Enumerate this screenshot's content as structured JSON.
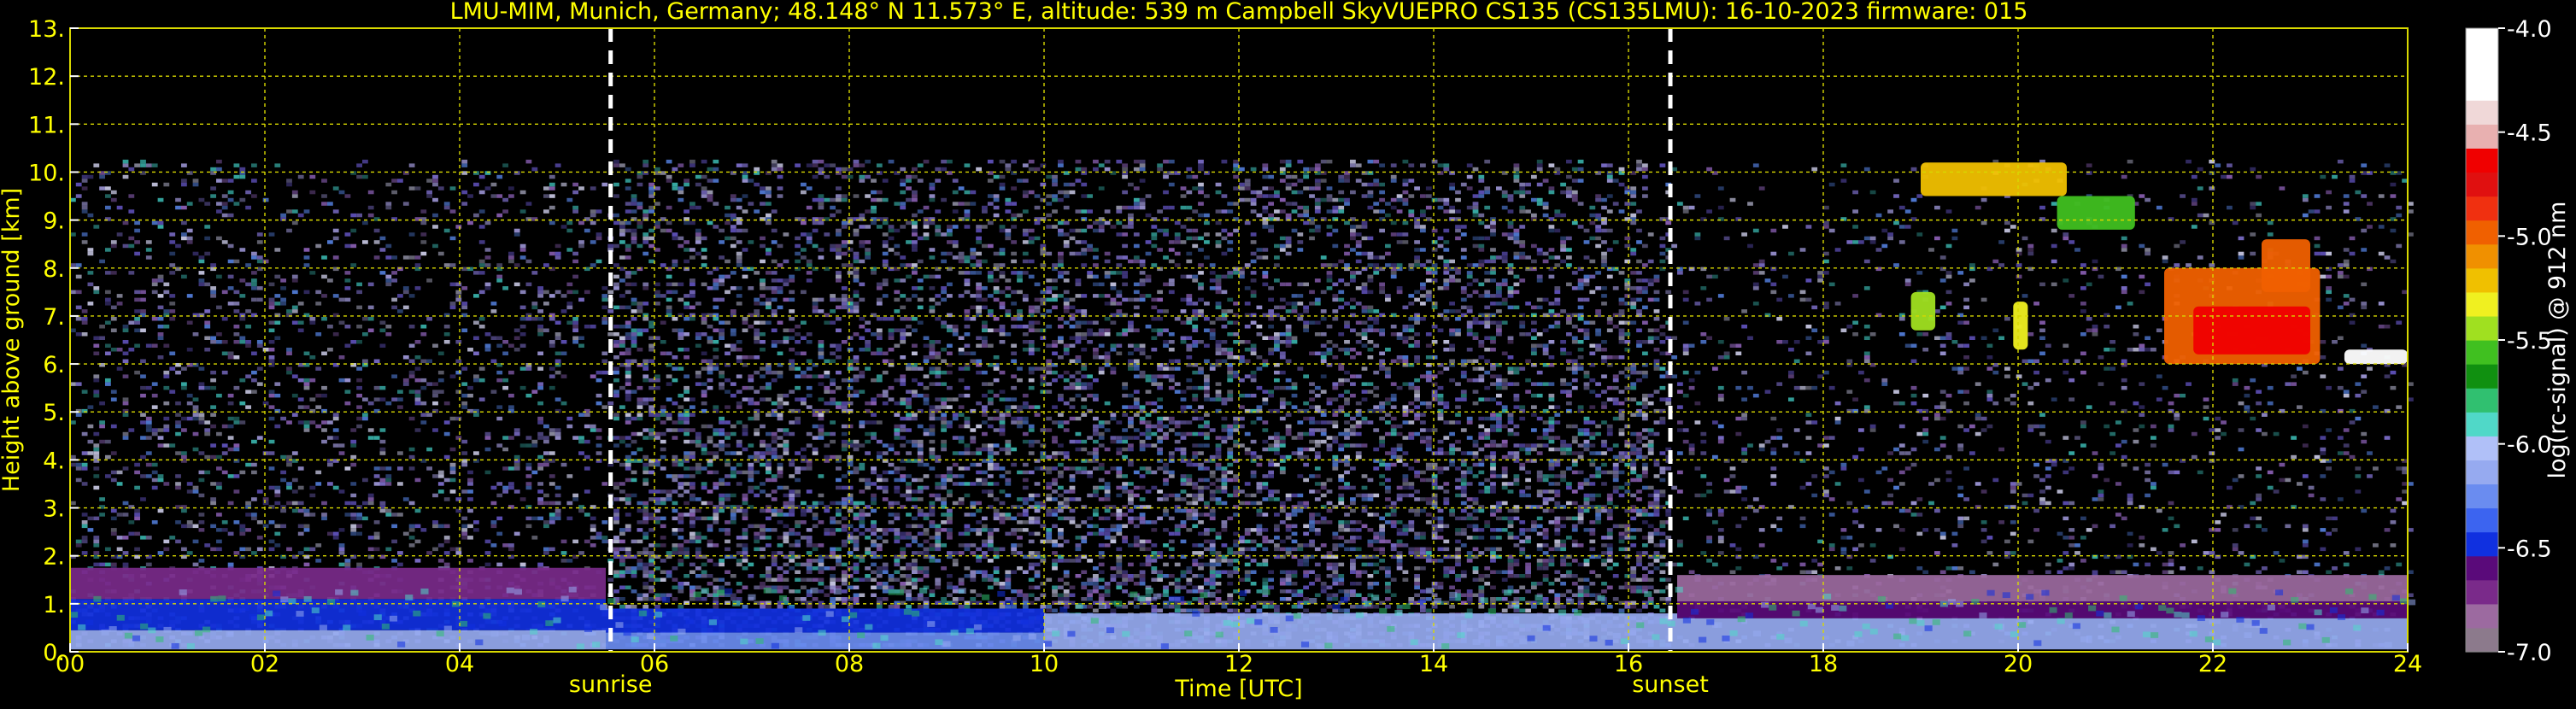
{
  "chart_data": {
    "type": "heatmap",
    "title": "LMU-MIM, Munich, Germany; 48.148° N 11.573° E, altitude: 539 m    Campbell SkyVUEPRO CS135 (CS135LMU): 16-10-2023    firmware: 015",
    "xlabel": "Time [UTC]",
    "ylabel": "Height above ground [km]",
    "colorbar_label": "log(rc-signal) @ 912 nm",
    "xlim": [
      0,
      24
    ],
    "ylim": [
      0,
      13
    ],
    "x_ticks": [
      0,
      2,
      4,
      6,
      8,
      10,
      12,
      14,
      16,
      18,
      20,
      22,
      24
    ],
    "x_tick_labels": [
      "00",
      "02",
      "04",
      "06",
      "08",
      "10",
      "12",
      "14",
      "16",
      "18",
      "20",
      "22",
      "24"
    ],
    "y_ticks": [
      0,
      1,
      2,
      3,
      4,
      5,
      6,
      7,
      8,
      9,
      10,
      11,
      12,
      13
    ],
    "y_tick_labels": [
      "0.",
      "1.",
      "2.",
      "3.",
      "4.",
      "5.",
      "6.",
      "7.",
      "8.",
      "9.",
      "10.",
      "11.",
      "12.",
      "13."
    ],
    "grid": true,
    "colorbar": {
      "ticks": [
        -4.0,
        -4.5,
        -5.0,
        -5.5,
        -6.0,
        -6.5,
        -7.0
      ],
      "tick_labels": [
        "-4.0",
        "-4.5",
        "-5.0",
        "-5.5",
        "-6.0",
        "-6.5",
        "-7.0"
      ],
      "range": [
        -7.0,
        -4.0
      ],
      "colors": [
        "#8c7a8c",
        "#9c6aa0",
        "#7a2a8a",
        "#5a0a7a",
        "#1030e0",
        "#3c64f0",
        "#6a8cf0",
        "#96aaf0",
        "#b0c0f8",
        "#50d8c8",
        "#30c070",
        "#109010",
        "#40c020",
        "#a0e020",
        "#f0f020",
        "#f0c000",
        "#f09000",
        "#f06000",
        "#f03010",
        "#e01010",
        "#f00000",
        "#e8b0b0",
        "#f0d8d8",
        "#ffffff",
        "#ffffff",
        "#ffffff"
      ]
    },
    "annotations": [
      {
        "label": "sunrise",
        "x": 5.55
      },
      {
        "label": "sunset",
        "x": 16.43
      }
    ],
    "signal_top_km": 10.2,
    "layers": [
      {
        "t0": 0.0,
        "t1": 5.5,
        "h0": 0.05,
        "h1": 0.45,
        "level": -6.1
      },
      {
        "t0": 0.0,
        "t1": 5.5,
        "h0": 0.45,
        "h1": 1.1,
        "level": -6.5
      },
      {
        "t0": 0.0,
        "t1": 5.5,
        "h0": 1.1,
        "h1": 1.75,
        "level": -6.75
      },
      {
        "t0": 5.5,
        "t1": 10.0,
        "h0": 0.05,
        "h1": 0.4,
        "level": -6.25
      },
      {
        "t0": 5.5,
        "t1": 10.0,
        "h0": 0.4,
        "h1": 0.9,
        "level": -6.5
      },
      {
        "t0": 10.0,
        "t1": 16.5,
        "h0": 0.05,
        "h1": 0.8,
        "level": -6.15
      },
      {
        "t0": 16.5,
        "t1": 24.0,
        "h0": 0.05,
        "h1": 0.7,
        "level": -6.15
      },
      {
        "t0": 16.5,
        "t1": 24.0,
        "h0": 0.7,
        "h1": 1.05,
        "level": -6.6
      },
      {
        "t0": 16.5,
        "t1": 24.0,
        "h0": 1.05,
        "h1": 1.6,
        "level": -6.85
      }
    ],
    "clouds": [
      {
        "t0": 21.5,
        "t1": 23.1,
        "h0": 6.0,
        "h1": 8.0,
        "level": -5.0
      },
      {
        "t0": 21.8,
        "t1": 23.0,
        "h0": 6.2,
        "h1": 7.2,
        "level": -4.6
      },
      {
        "t0": 22.5,
        "t1": 23.0,
        "h0": 7.5,
        "h1": 8.6,
        "level": -5.0
      },
      {
        "t0": 19.0,
        "t1": 20.5,
        "h0": 9.5,
        "h1": 10.2,
        "level": -5.2
      },
      {
        "t0": 20.4,
        "t1": 21.2,
        "h0": 8.8,
        "h1": 9.5,
        "level": -5.6
      },
      {
        "t0": 18.9,
        "t1": 19.15,
        "h0": 6.7,
        "h1": 7.5,
        "level": -5.4
      },
      {
        "t0": 19.95,
        "t1": 20.1,
        "h0": 6.3,
        "h1": 7.3,
        "level": -5.3
      },
      {
        "t0": 23.35,
        "t1": 24.0,
        "h0": 6.0,
        "h1": 6.3,
        "level": -4.1
      }
    ]
  }
}
